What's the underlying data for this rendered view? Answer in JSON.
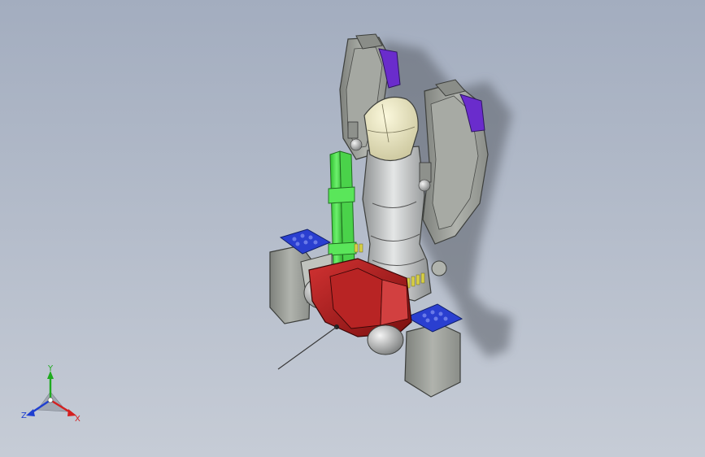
{
  "viewport": {
    "background_top": "#a3adbf",
    "background_bottom": "#c6ccd6"
  },
  "model": {
    "colors": {
      "housing": "#9a9d97",
      "housing_dark": "#6e716c",
      "dome": "#e6e2b8",
      "body_metal": "#b9bcbc",
      "green_part": "#3bdc3b",
      "red_part": "#a81a1a",
      "blue_pad": "#2a3fd0",
      "purple_cap": "#6a2ccc",
      "yellow_pins": "#d8d046"
    }
  },
  "triad": {
    "x_label": "X",
    "y_label": "Y",
    "z_label": "Z",
    "x_color": "#d42020",
    "y_color": "#1faa1f",
    "z_color": "#1f3fd0"
  }
}
